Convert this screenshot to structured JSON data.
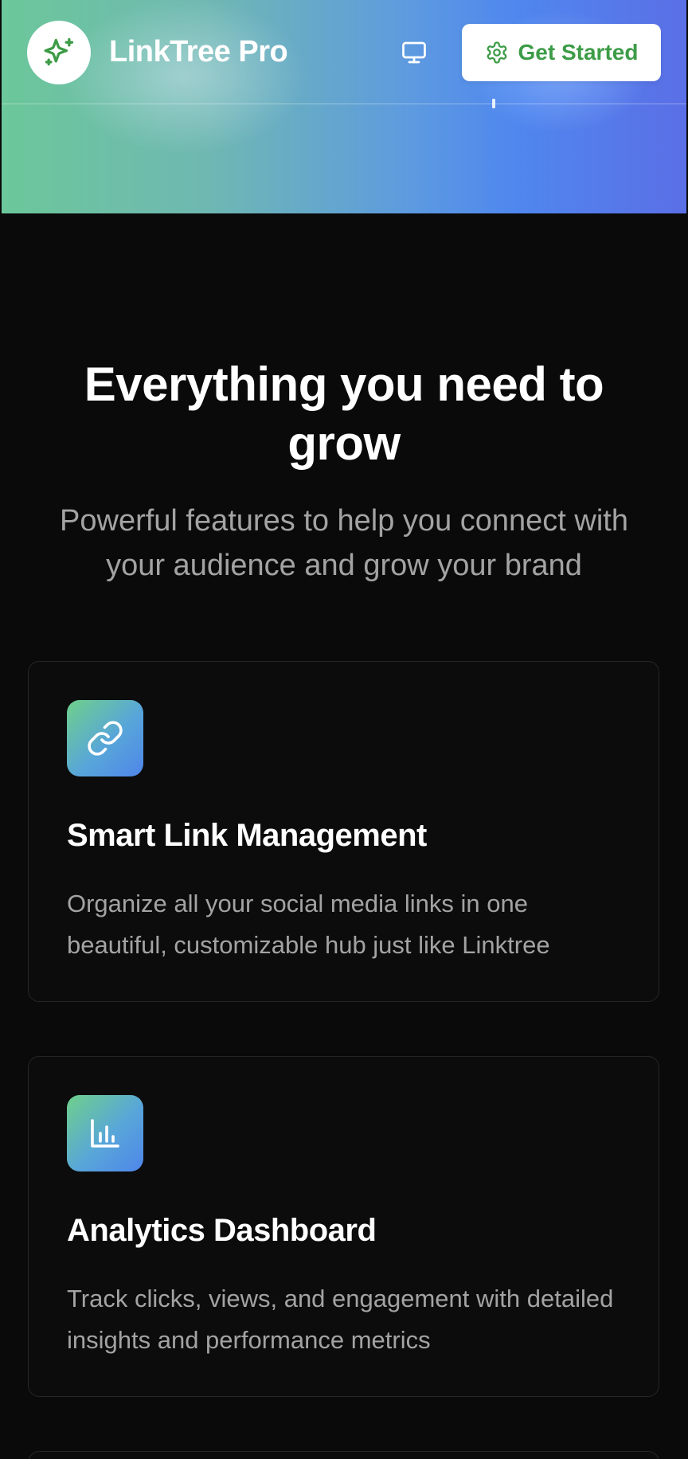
{
  "header": {
    "brand_name": "LinkTree Pro",
    "logo_icon": "sparkles-icon",
    "monitor_icon": "monitor-icon",
    "cta_label": "Get Started",
    "cta_icon": "gear-icon"
  },
  "features": {
    "title": "Everything you need to grow",
    "subtitle": "Powerful features to help you connect with your audience and grow your brand",
    "cards": [
      {
        "icon": "link-icon",
        "title": "Smart Link Management",
        "description": "Organize all your social media links in one beautiful, customizable hub just like Linktree"
      },
      {
        "icon": "bar-chart-icon",
        "title": "Analytics Dashboard",
        "description": "Track clicks, views, and engagement with detailed insights and performance metrics"
      }
    ]
  },
  "colors": {
    "page_background": "#0a0a0a",
    "accent_green": "#3d9c47",
    "gradient_start": "#6cc79a",
    "gradient_end": "#5b6fe6",
    "muted_text": "#a3a3a3"
  }
}
